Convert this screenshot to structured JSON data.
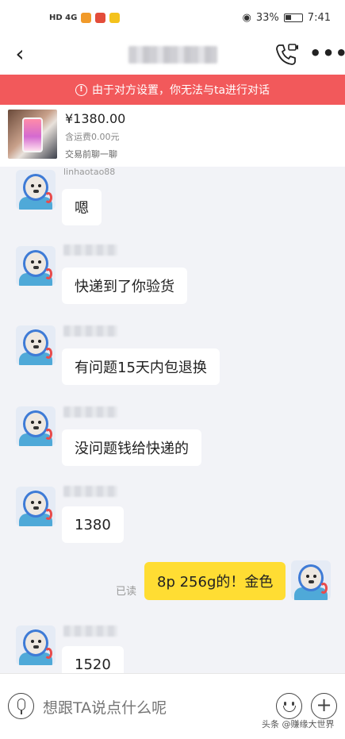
{
  "status_bar": {
    "network": "HD 4G",
    "battery": "33%",
    "time": "7:41"
  },
  "header": {
    "back_icon": "chevron-left-icon",
    "call_icon": "phone-video-icon",
    "more_icon": "more-dots-icon"
  },
  "banner": {
    "text": "由于对方设置，你无法与ta进行对话",
    "color": "#f2595b"
  },
  "product": {
    "price": "¥1380.00",
    "shipping": "含运费0.00元",
    "note": "交易前聊一聊"
  },
  "messages": [
    {
      "from": "other",
      "sender": "linhaotao88",
      "text": "嗯"
    },
    {
      "from": "other",
      "sender": "",
      "text": "快递到了你验货"
    },
    {
      "from": "other",
      "sender": "",
      "text": "有问题15天内包退换"
    },
    {
      "from": "other",
      "sender": "",
      "text": "没问题钱给快递的"
    },
    {
      "from": "other",
      "sender": "",
      "text": "1380"
    },
    {
      "from": "me",
      "status": "已读",
      "text": "8p 256g的！金色"
    },
    {
      "from": "other",
      "sender": "",
      "text": "1520"
    }
  ],
  "input": {
    "placeholder": "想跟TA说点什么呢"
  },
  "watermark": "头条 @赚缘大世界",
  "colors": {
    "accent_banner": "#f2595b",
    "my_bubble": "#ffdd33",
    "other_bubble": "#ffffff",
    "background": "#f2f3f7"
  }
}
